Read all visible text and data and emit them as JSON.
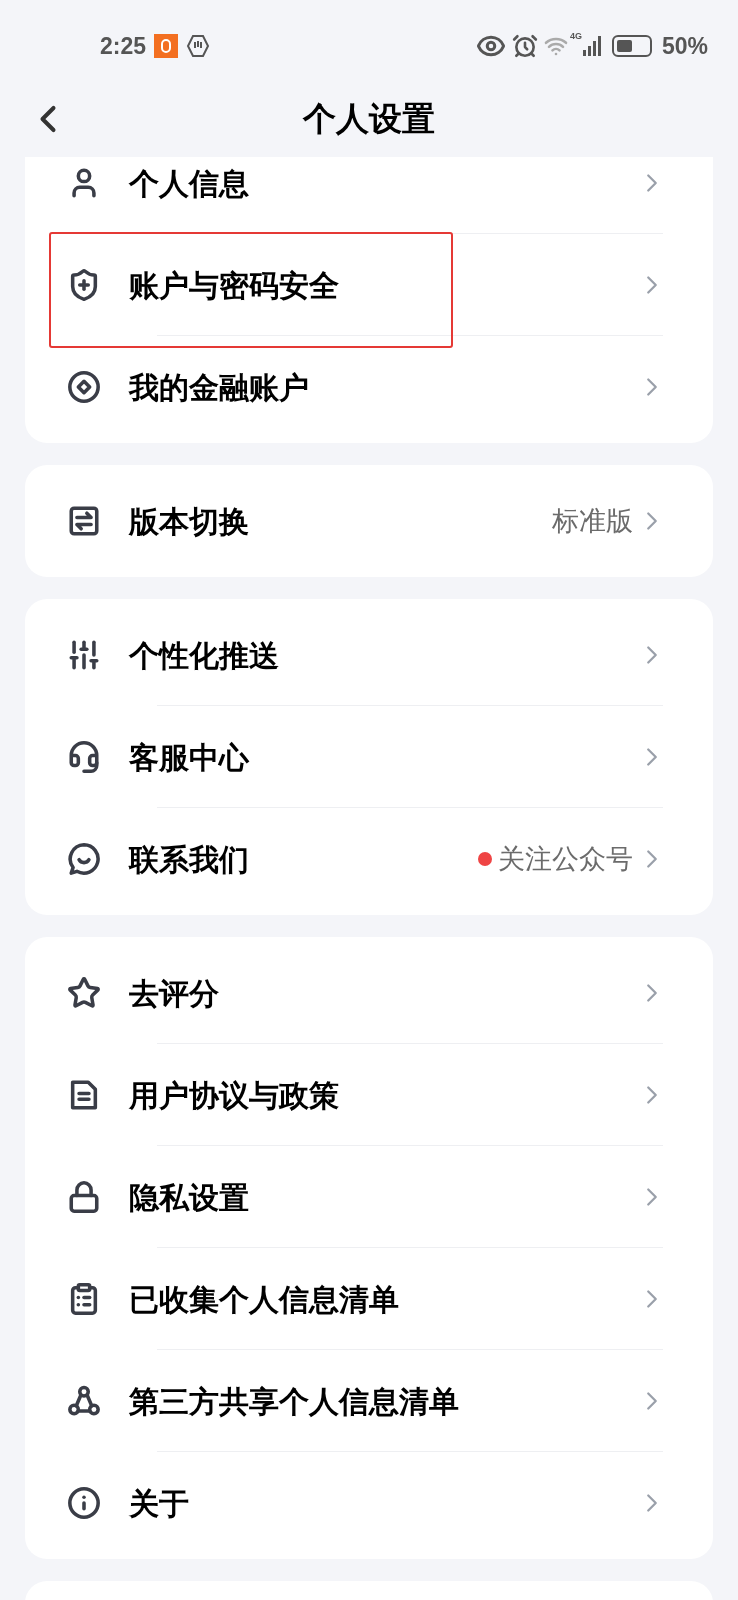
{
  "status_bar": {
    "time": "2:25",
    "network": "4G",
    "battery": "50%"
  },
  "header": {
    "title": "个人设置"
  },
  "groups": [
    {
      "items": [
        {
          "label": "个人信息",
          "highlighted": false,
          "dot": false
        },
        {
          "label": "账户与密码安全",
          "highlighted": true,
          "dot": false
        },
        {
          "label": "我的金融账户",
          "highlighted": false,
          "dot": false
        }
      ]
    },
    {
      "items": [
        {
          "label": "版本切换",
          "value": "标准版",
          "highlighted": false,
          "dot": false
        }
      ]
    },
    {
      "items": [
        {
          "label": "个性化推送",
          "highlighted": false,
          "dot": false
        },
        {
          "label": "客服中心",
          "highlighted": false,
          "dot": false
        },
        {
          "label": "联系我们",
          "value": "关注公众号",
          "highlighted": false,
          "dot": true
        }
      ]
    },
    {
      "items": [
        {
          "label": "去评分",
          "highlighted": false,
          "dot": false
        },
        {
          "label": "用户协议与政策",
          "highlighted": false,
          "dot": false
        },
        {
          "label": "隐私设置",
          "highlighted": false,
          "dot": false
        },
        {
          "label": "已收集个人信息清单",
          "highlighted": false,
          "dot": false
        },
        {
          "label": "第三方共享个人信息清单",
          "highlighted": false,
          "dot": false
        },
        {
          "label": "关于",
          "highlighted": false,
          "dot": false
        }
      ]
    }
  ]
}
